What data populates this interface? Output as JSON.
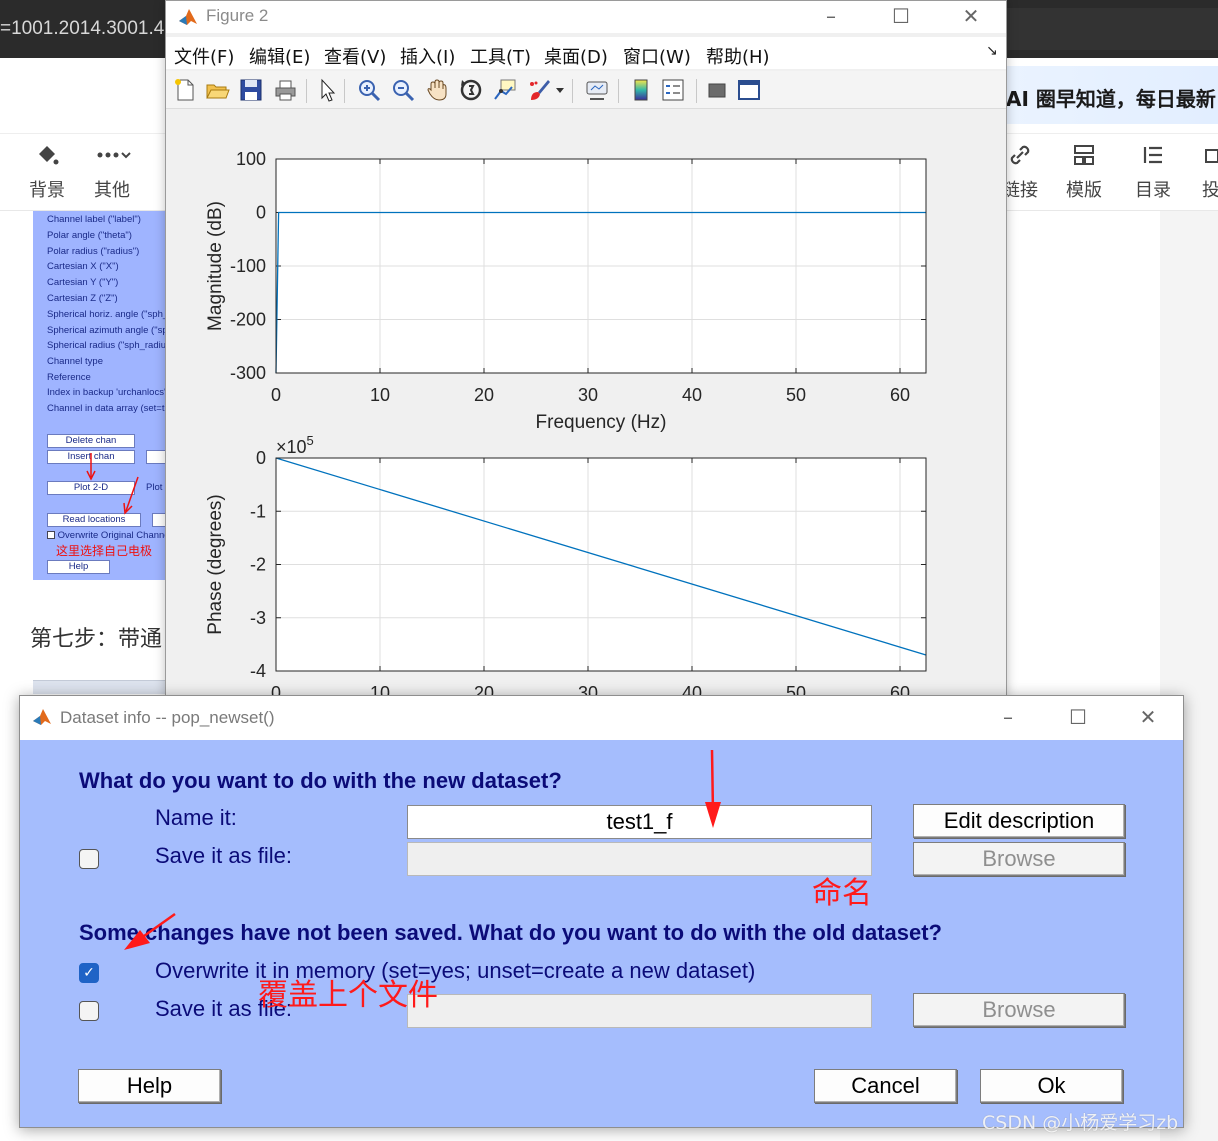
{
  "background_page": {
    "url_fragment": "=1001.2014.3001.4",
    "ai_banner": "AI 圈早知道，每日最新",
    "toolbar_left": [
      {
        "icon": "paint-bucket-icon",
        "label": "背景"
      },
      {
        "icon": "more-dots-icon",
        "label": "其他"
      }
    ],
    "toolbar_right": [
      {
        "icon": "link-icon",
        "label": "链接"
      },
      {
        "icon": "template-icon",
        "label": "模版"
      },
      {
        "icon": "toc-list-icon",
        "label": "目录"
      },
      {
        "icon": "submit-icon",
        "label": "投"
      }
    ],
    "step_heading": "第七步：带通",
    "embedded_screenshot": {
      "field_labels": [
        "Channel label (\"label\")",
        "Polar angle (\"theta\")",
        "Polar radius (\"radius\")",
        "Cartesian X (\"X\")",
        "Cartesian Y (\"Y\")",
        "Cartesian Z (\"Z\")",
        "Spherical horiz. angle (\"sph_theta\")",
        "Spherical azimuth angle (\"sph_phi\")",
        "Spherical radius (\"sph_radius\")",
        "Channel type",
        "Reference",
        "Index in backup 'urchanlocs'",
        "Channel in data array (set=true)"
      ],
      "buttons": {
        "delete_chan": "Delete chan",
        "insert_chan": "Insert chan",
        "plot_2d": "Plot 2-D",
        "plot_3d": "Plot",
        "read_locations": "Read locations",
        "help": "Help"
      },
      "overwrite_label": "Overwrite Original Channels",
      "red_note": "这里选择自己电极"
    }
  },
  "figure_window": {
    "title": "Figure 2",
    "menus": [
      "文件(F)",
      "编辑(E)",
      "查看(V)",
      "插入(I)",
      "工具(T)",
      "桌面(D)",
      "窗口(W)",
      "帮助(H)"
    ],
    "menu_overflow_glyph": "↘",
    "toolbar_icons": [
      "new-figure-icon",
      "open-file-icon",
      "save-icon",
      "print-icon",
      "pointer-icon",
      "zoom-in-icon",
      "zoom-out-icon",
      "pan-hand-icon",
      "rotate-3d-icon",
      "data-cursor-icon",
      "brush-icon",
      "brush-dropdown-icon",
      "link-plot-icon",
      "colorbar-icon",
      "legend-icon",
      "hide-plot-tools-icon",
      "show-plot-tools-icon"
    ]
  },
  "chart_data": [
    {
      "type": "line",
      "xlabel": "Frequency (Hz)",
      "ylabel": "Magnitude (dB)",
      "xlim": [
        0,
        62.5
      ],
      "ylim": [
        -300,
        100
      ],
      "x_ticks": [
        "0",
        "10",
        "20",
        "30",
        "40",
        "50",
        "60"
      ],
      "y_ticks": [
        "100",
        "0",
        "-100",
        "-200",
        "-300"
      ],
      "grid": true,
      "series_color": "#0072bd",
      "x": [
        0,
        0.25,
        62.5
      ],
      "y": [
        -300,
        0,
        0
      ]
    },
    {
      "type": "line",
      "xlabel": "",
      "ylabel": "Phase (degrees)",
      "y_multiplier": "×10",
      "y_multiplier_exponent": "5",
      "xlim": [
        0,
        62.5
      ],
      "ylim": [
        -4,
        0
      ],
      "x_ticks": [
        "0",
        "10",
        "20",
        "30",
        "40",
        "50",
        "60"
      ],
      "y_ticks": [
        "0",
        "-1",
        "-2",
        "-3",
        "-4"
      ],
      "grid": true,
      "series_color": "#0072bd",
      "x": [
        0,
        62.5
      ],
      "y": [
        0,
        -3.7
      ]
    }
  ],
  "dialog": {
    "title": "Dataset info -- pop_newset()",
    "heading_new": "What do you want to do with the new dataset?",
    "name_label": "Name it:",
    "name_value": "test1_f",
    "edit_description_button": "Edit description",
    "save_file_label_1": "Save it as file:",
    "save_file_checked_1": false,
    "browse_button_1": "Browse",
    "heading_old": "Some changes have not been saved. What do you want to do with the old dataset?",
    "overwrite_label": "Overwrite it in memory (set=yes; unset=create a new dataset)",
    "overwrite_checked": true,
    "save_file_label_2": "Save it as file:",
    "save_file_checked_2": false,
    "browse_button_2": "Browse",
    "help_button": "Help",
    "cancel_button": "Cancel",
    "ok_button": "Ok",
    "background_color": "#a5bdfd",
    "text_color": "#0b0b78"
  },
  "annotations": {
    "rename_note": "命名",
    "overwrite_note": "覆盖上个文件",
    "color": "#ff1a1a"
  },
  "watermark": "CSDN @小杨爱学习zb"
}
